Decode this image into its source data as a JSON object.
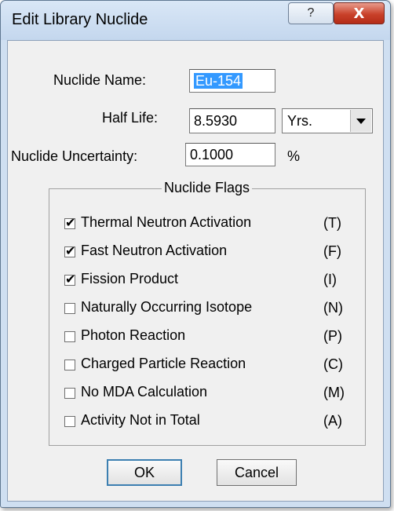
{
  "window": {
    "title": "Edit Library Nuclide"
  },
  "titlebar_buttons": {
    "help_label": "?",
    "close_label": "X"
  },
  "form": {
    "nuclide_name_label": "Nuclide Name:",
    "nuclide_name_value": "Eu-154",
    "half_life_label": "Half Life:",
    "half_life_value": "8.5930",
    "half_life_unit": "Yrs.",
    "uncertainty_label": "Nuclide Uncertainty:",
    "uncertainty_value": "0.1000",
    "uncertainty_unit": "%"
  },
  "flags_group": {
    "title": "Nuclide Flags",
    "items": [
      {
        "label": "Thermal Neutron Activation",
        "code": "(T)",
        "checked": true
      },
      {
        "label": "Fast Neutron Activation",
        "code": "(F)",
        "checked": true
      },
      {
        "label": "Fission Product",
        "code": "(I)",
        "checked": true
      },
      {
        "label": "Naturally Occurring Isotope",
        "code": "(N)",
        "checked": false
      },
      {
        "label": "Photon Reaction",
        "code": "(P)",
        "checked": false
      },
      {
        "label": "Charged Particle Reaction",
        "code": "(C)",
        "checked": false
      },
      {
        "label": "No MDA Calculation",
        "code": "(M)",
        "checked": false
      },
      {
        "label": "Activity Not in Total",
        "code": "(A)",
        "checked": false
      }
    ]
  },
  "buttons": {
    "ok_label": "OK",
    "cancel_label": "Cancel"
  },
  "check_mark": "✔"
}
